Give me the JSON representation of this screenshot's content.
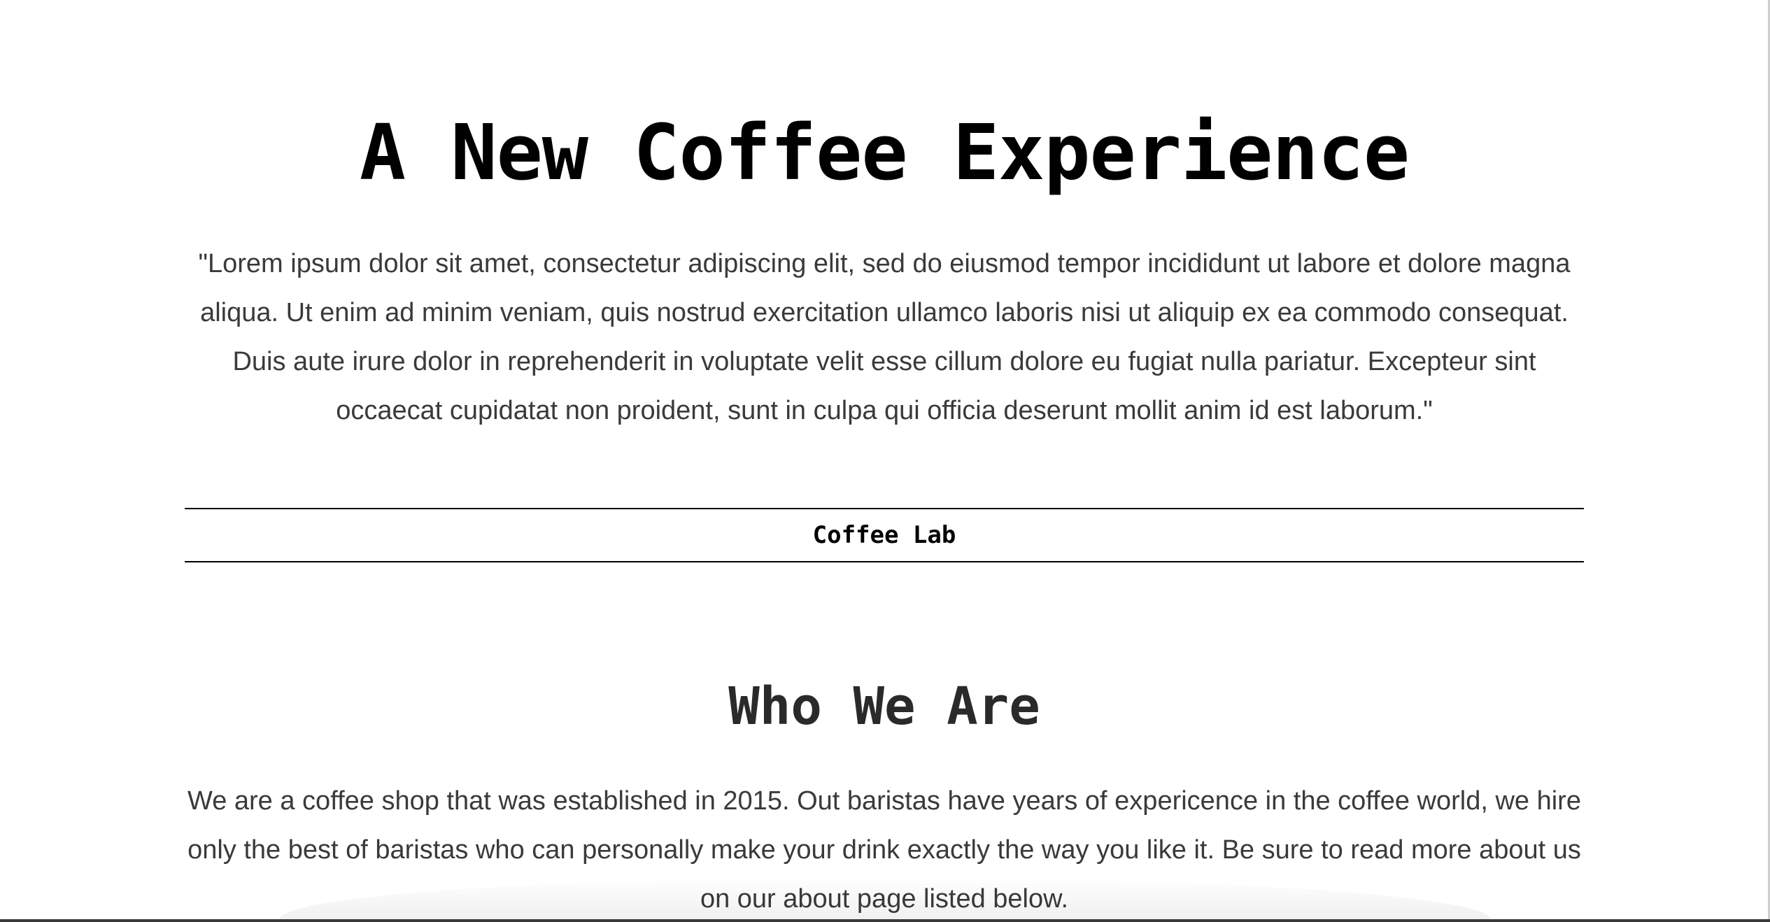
{
  "hero": {
    "title": "A New Coffee Experience",
    "quote": "\"Lorem ipsum dolor sit amet, consectetur adipiscing elit, sed do eiusmod tempor incididunt ut labore et dolore magna aliqua. Ut enim ad minim veniam, quis nostrud exercitation ullamco laboris nisi ut aliquip ex ea commodo consequat. Duis aute irure dolor in reprehenderit in voluptate velit esse cillum dolore eu fugiat nulla pariatur. Excepteur sint occaecat cupidatat non proident, sunt in culpa qui officia deserunt mollit anim id est laborum.\""
  },
  "brand": {
    "name": "Coffee Lab"
  },
  "about": {
    "title": "Who We Are",
    "body": "We are a coffee shop that was established in 2015. Out baristas have years of expericence in the coffee world, we hire only the best of baristas who can personally make your drink exactly the way you like it. Be sure to read more about us on our about page listed below."
  }
}
